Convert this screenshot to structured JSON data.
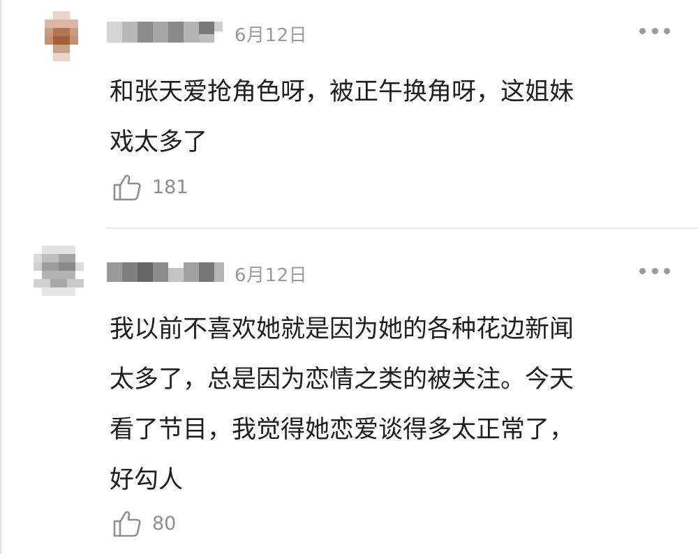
{
  "comments": [
    {
      "date": "6月12日",
      "text_lines": [
        "和张天爱抢角色呀，被正午换角呀，这姐妹",
        "戏太多了"
      ],
      "likes": "181",
      "avatar_icon": "blurred-avatar-icon",
      "more_icon": "more-options-icon",
      "like_icon": "thumbs-up-icon"
    },
    {
      "date": "6月12日",
      "text_lines": [
        "我以前不喜欢她就是因为她的各种花边新闻",
        "太多了，总是因为恋情之类的被关注。今天",
        "看了节目，我觉得她恋爱谈得多太正常了，",
        "好勾人"
      ],
      "likes": "80",
      "avatar_icon": "blurred-avatar-icon",
      "more_icon": "more-options-icon",
      "like_icon": "thumbs-up-icon"
    }
  ],
  "colors": {
    "meta_text": "#9a9a9a",
    "body_text": "#1e1e1e",
    "divider": "#e6e6e6"
  }
}
